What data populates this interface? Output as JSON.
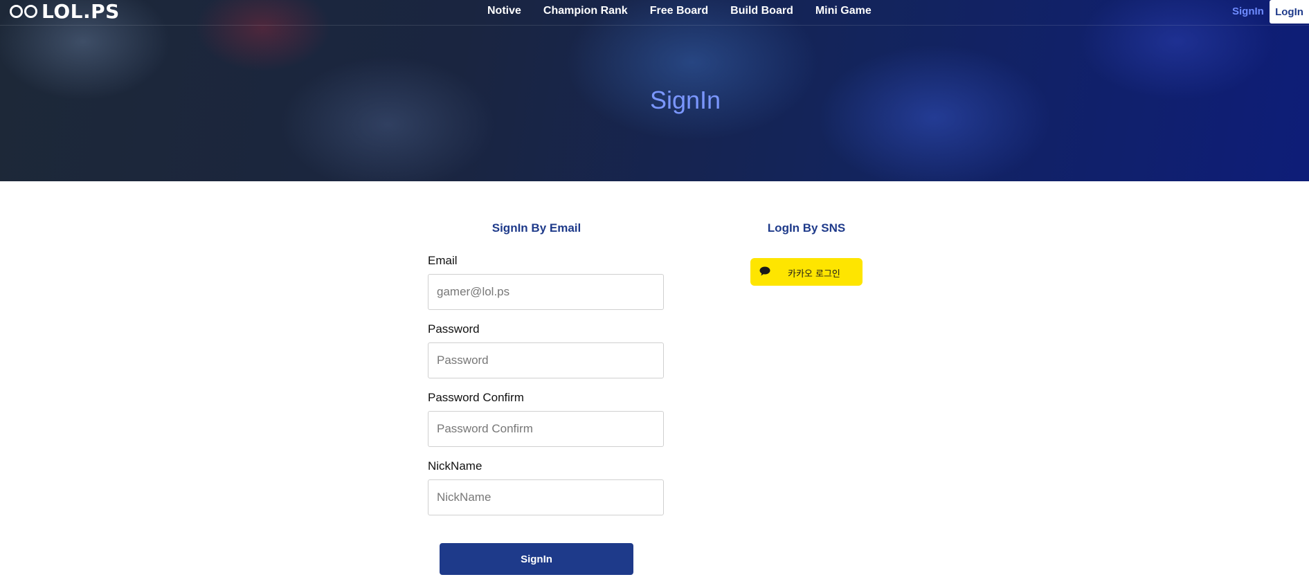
{
  "header": {
    "logo_text": "LOL.PS",
    "nav": [
      "Notive",
      "Champion Rank",
      "Free Board",
      "Build Board",
      "Mini Game"
    ],
    "signin_link": "SignIn",
    "login_button": "LogIn"
  },
  "hero": {
    "title": "SignIn"
  },
  "email_form": {
    "title": "SignIn By Email",
    "fields": [
      {
        "label": "Email",
        "placeholder": "gamer@lol.ps",
        "value": ""
      },
      {
        "label": "Password",
        "placeholder": "Password",
        "value": ""
      },
      {
        "label": "Password Confirm",
        "placeholder": "Password Confirm",
        "value": ""
      },
      {
        "label": "NickName",
        "placeholder": "NickName",
        "value": ""
      }
    ],
    "submit_label": "SignIn"
  },
  "sns": {
    "title": "LogIn By SNS",
    "kakao_label": "카카오 로그인",
    "kakao_icon": "speech-bubble-icon",
    "kakao_color": "#fee500"
  },
  "colors": {
    "brand": "#1e3a8a",
    "hero_title": "#7b97ff",
    "signin_link": "#6f8cff"
  }
}
